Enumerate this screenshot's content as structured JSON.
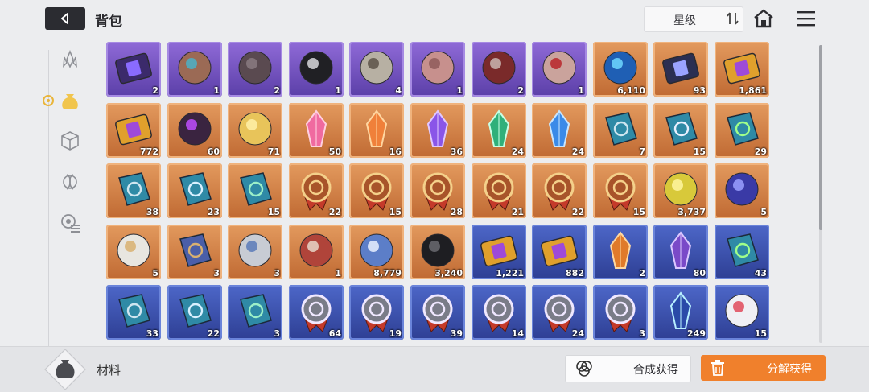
{
  "header": {
    "title": "背包",
    "sort_label": "星级"
  },
  "sidebar": {
    "items": [
      {
        "icon": "crystal-icon",
        "active": false
      },
      {
        "icon": "material-bag-icon",
        "active": true
      },
      {
        "icon": "cube-icon",
        "active": false
      },
      {
        "icon": "dna-icon",
        "active": false
      },
      {
        "icon": "gear-list-icon",
        "active": false
      }
    ]
  },
  "items": [
    [
      {
        "frame": "purple",
        "icon": "card",
        "count": "2"
      },
      {
        "frame": "purple",
        "icon": "head",
        "count": "1"
      },
      {
        "frame": "purple",
        "icon": "brain",
        "count": "2"
      },
      {
        "frame": "purple",
        "icon": "orb",
        "count": "1"
      },
      {
        "frame": "purple",
        "icon": "skull",
        "count": "4"
      },
      {
        "frame": "purple",
        "icon": "face",
        "count": "1"
      },
      {
        "frame": "purple",
        "icon": "organ",
        "count": "2"
      },
      {
        "frame": "purple",
        "icon": "eye",
        "count": "1"
      },
      {
        "frame": "orange",
        "icon": "blue-orb",
        "count": "6,110"
      },
      {
        "frame": "orange",
        "icon": "chip",
        "count": "93"
      },
      {
        "frame": "orange",
        "icon": "ticket",
        "count": "1,861"
      }
    ],
    [
      {
        "frame": "orange",
        "icon": "ticket",
        "count": "772"
      },
      {
        "frame": "orange",
        "icon": "purple-eye",
        "count": "60"
      },
      {
        "frame": "orange",
        "icon": "feather",
        "count": "71"
      },
      {
        "frame": "orange",
        "icon": "crystal-pink",
        "count": "50"
      },
      {
        "frame": "orange",
        "icon": "crystal-orange",
        "count": "16"
      },
      {
        "frame": "orange",
        "icon": "crystal-purple",
        "count": "36"
      },
      {
        "frame": "orange",
        "icon": "crystal-green",
        "count": "24"
      },
      {
        "frame": "orange",
        "icon": "crystal-blue",
        "count": "24"
      },
      {
        "frame": "orange",
        "icon": "book-x",
        "count": "7"
      },
      {
        "frame": "orange",
        "icon": "book-shield",
        "count": "15"
      },
      {
        "frame": "orange",
        "icon": "book-eye",
        "count": "29"
      }
    ],
    [
      {
        "frame": "orange",
        "icon": "book-x",
        "count": "38"
      },
      {
        "frame": "orange",
        "icon": "book-circle",
        "count": "23"
      },
      {
        "frame": "orange",
        "icon": "book-rose",
        "count": "15"
      },
      {
        "frame": "orange",
        "icon": "badge",
        "count": "22"
      },
      {
        "frame": "orange",
        "icon": "badge",
        "count": "15"
      },
      {
        "frame": "orange",
        "icon": "badge",
        "count": "28"
      },
      {
        "frame": "orange",
        "icon": "badge",
        "count": "21"
      },
      {
        "frame": "orange",
        "icon": "badge",
        "count": "22"
      },
      {
        "frame": "orange",
        "icon": "badge",
        "count": "15"
      },
      {
        "frame": "orange",
        "icon": "leaf",
        "count": "3,737"
      },
      {
        "frame": "orange",
        "icon": "cube-gem",
        "count": "5"
      }
    ],
    [
      {
        "frame": "orange",
        "icon": "shoes",
        "count": "5"
      },
      {
        "frame": "orange",
        "icon": "tome",
        "count": "3"
      },
      {
        "frame": "orange",
        "icon": "sprayer",
        "count": "3"
      },
      {
        "frame": "orange",
        "icon": "dreamcatcher",
        "count": "1"
      },
      {
        "frame": "orange",
        "icon": "music",
        "count": "8,779"
      },
      {
        "frame": "orange",
        "icon": "urchin",
        "count": "3,240"
      },
      {
        "frame": "blue",
        "icon": "ticket",
        "count": "1,221"
      },
      {
        "frame": "blue",
        "icon": "ticket",
        "count": "882"
      },
      {
        "frame": "blue",
        "icon": "shard-orange",
        "count": "2"
      },
      {
        "frame": "blue",
        "icon": "shard-purple",
        "count": "80"
      },
      {
        "frame": "blue",
        "icon": "book-eye",
        "count": "43"
      }
    ],
    [
      {
        "frame": "blue",
        "icon": "book-x",
        "count": "33"
      },
      {
        "frame": "blue",
        "icon": "book-circle",
        "count": "22"
      },
      {
        "frame": "blue",
        "icon": "book-rose",
        "count": "3"
      },
      {
        "frame": "blue",
        "icon": "medal",
        "count": "64"
      },
      {
        "frame": "blue",
        "icon": "medal",
        "count": "19"
      },
      {
        "frame": "blue",
        "icon": "medal",
        "count": "39"
      },
      {
        "frame": "blue",
        "icon": "medal",
        "count": "14"
      },
      {
        "frame": "blue",
        "icon": "medal",
        "count": "24"
      },
      {
        "frame": "blue",
        "icon": "medal",
        "count": "3"
      },
      {
        "frame": "blue",
        "icon": "ice-crystal",
        "count": "249"
      },
      {
        "frame": "blue",
        "icon": "cake",
        "count": "15"
      }
    ]
  ],
  "bottom": {
    "category_label": "材料",
    "compose_label": "合成获得",
    "decompose_label": "分解获得"
  },
  "colors": {
    "accent_orange": "#f0802c",
    "frame_purple": "#7b58c9",
    "frame_orange": "#d8874f",
    "frame_blue": "#3c57b9"
  }
}
